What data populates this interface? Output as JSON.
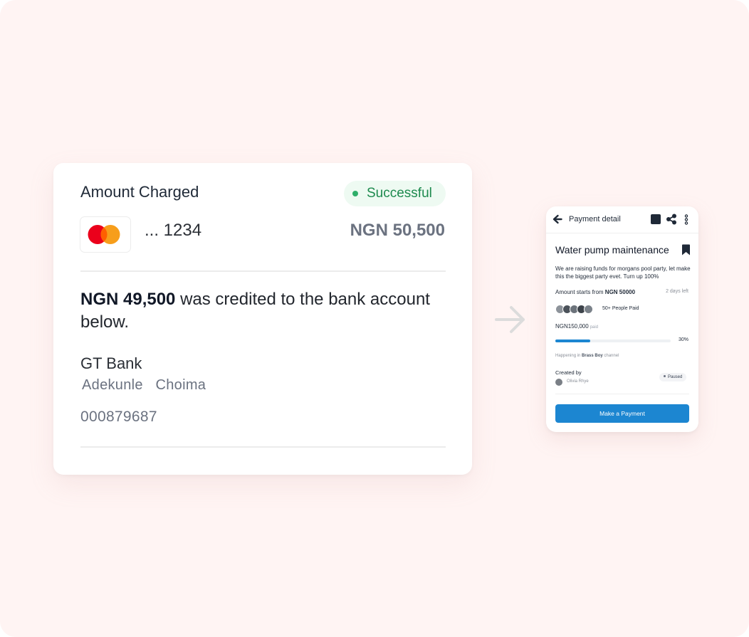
{
  "receipt": {
    "title": "Amount Charged",
    "status": "Successful",
    "card_digits": "... 1234",
    "amount_charged": "NGN 50,500",
    "credited_amount": "NGN 49,500",
    "credited_text": " was credited to the bank account below.",
    "bank_name": "GT Bank",
    "account_name": "Adekunle  Choima",
    "account_number": "000879687"
  },
  "payment_detail": {
    "header_title": "Payment detail",
    "heading": "Water pump maintenance",
    "description": "We are raising funds for morgans pool party, let make this the biggest party evet. Turn up 100%",
    "starts_label": "Amount starts from ",
    "starts_amount": "NGN 50000",
    "days_left": "2 days left",
    "people_paid": "50+ People Paid",
    "raised": "NGN150,000",
    "raised_suffix": "paid",
    "progress_fraction": 0.3,
    "progress_label": "30%",
    "happening_prefix": "Happening in ",
    "happening_channel": "Brass Boy",
    "happening_suffix": " channel",
    "created_by_label": "Created by",
    "creator": "Olivia Rhye",
    "status": "Paused",
    "cta": "Make a Payment"
  },
  "colors": {
    "background": "#fff4f3",
    "success": "#2eae69",
    "primary": "#1c86d1",
    "mastercard_red": "#eb001b",
    "mastercard_orange": "#f79e1b"
  },
  "icons": [
    "mastercard-logo",
    "arrow-right-icon",
    "arrow-left-icon",
    "square-icon",
    "share-icon",
    "more-vertical-icon",
    "bookmark-icon"
  ]
}
